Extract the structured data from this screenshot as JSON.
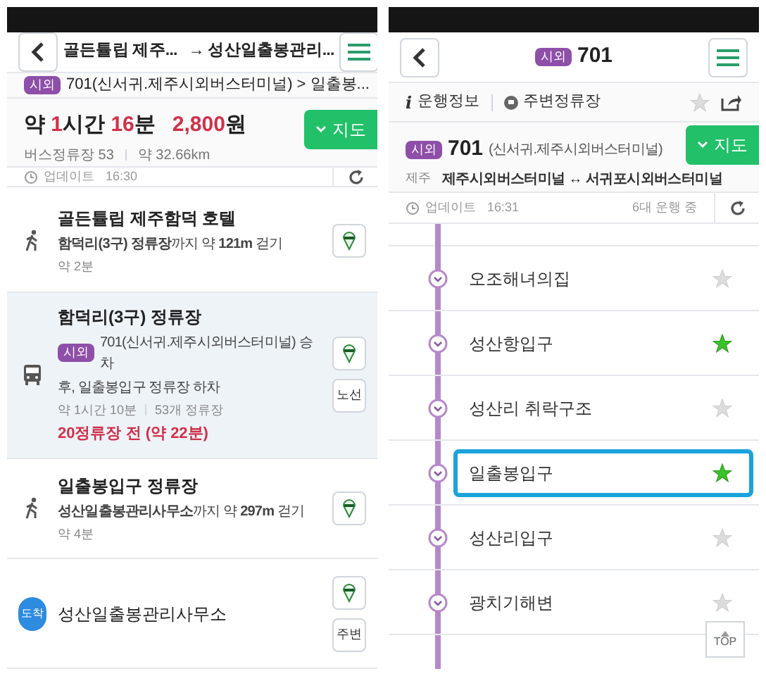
{
  "left": {
    "header": {
      "from": "골든튤립 제주...",
      "to": "→ 성산일출봉관리..."
    },
    "route": {
      "badge": "시외",
      "text": "701(신서귀.제주시외버스터미널) > 일출봉..."
    },
    "summary": {
      "parts": [
        {
          "text": "약 ",
          "highlight": false
        },
        {
          "text": "1",
          "highlight": true
        },
        {
          "text": "시간 ",
          "highlight": false
        },
        {
          "text": "16",
          "highlight": true
        },
        {
          "text": "분",
          "highlight": false
        }
      ],
      "fare": [
        {
          "text": "2,800",
          "highlight": true
        },
        {
          "text": "원",
          "highlight": false
        }
      ],
      "stops": "버스정류장 53",
      "distance": "약 32.66km",
      "map_button": "지도"
    },
    "update": {
      "label": "업데이트",
      "time": "16:30"
    },
    "steps": [
      {
        "kind": "walk",
        "selected": false,
        "title": "골든튤립 제주함덕 호텔",
        "lines": [
          "**함덕리(3구) 정류장**까지 약 **121m** 걷기"
        ],
        "sub": "약 2분"
      },
      {
        "kind": "bus",
        "selected": true,
        "title": "함덕리(3구) 정류장",
        "badge": "시외",
        "lines": [
          "701(신서귀.제주시외버스터미널) 승차",
          "후, 일출봉입구 정류장 하차"
        ],
        "sub": "약 1시간 10분",
        "sub2": "53개 정류장",
        "alert": "20정류장 전 (약 22분)",
        "buttons": [
          "노선"
        ]
      },
      {
        "kind": "walk",
        "selected": false,
        "title": "일출봉입구 정류장",
        "lines": [
          "**성산일출봉관리사무소**까지 약 **297m** 걷기"
        ],
        "sub": "약 4분"
      },
      {
        "kind": "arrive",
        "selected": false,
        "badge": "도착",
        "title": "성산일출봉관리사무소",
        "buttons": [
          "주변"
        ]
      }
    ]
  },
  "right": {
    "header": {
      "badge": "시외",
      "title": "701"
    },
    "toolbar": {
      "info_icon": "i",
      "info": "운행정보",
      "nearby": "주변정류장"
    },
    "route": {
      "badge": "시외",
      "number": "701",
      "terminal": "(신서귀.제주시외버스터미널)",
      "region": "제주",
      "path": "제주시외버스터미널 ↔ 서귀포시외버스터미널",
      "map_button": "지도"
    },
    "update": {
      "label": "업데이트",
      "time": "16:31",
      "running": "6대 운행 중"
    },
    "stops": [
      {
        "name": "오조해녀의집",
        "favorite": false,
        "selected": false
      },
      {
        "name": "성산항입구",
        "favorite": true,
        "selected": false
      },
      {
        "name": "성산리 취락구조",
        "favorite": false,
        "selected": false
      },
      {
        "name": "일출봉입구",
        "favorite": true,
        "selected": true
      },
      {
        "name": "성산리입구",
        "favorite": false,
        "selected": false
      },
      {
        "name": "광치기해변",
        "favorite": false,
        "selected": false
      }
    ],
    "top_button": "TOP"
  }
}
